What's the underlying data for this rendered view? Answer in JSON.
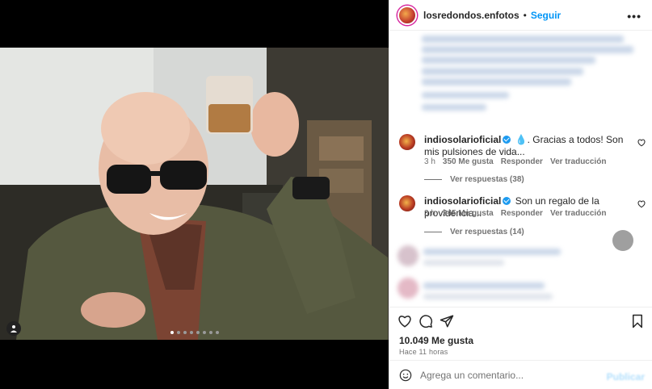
{
  "post": {
    "header": {
      "username": "losredondos.enfotos",
      "separator": "•",
      "follow_label": "Seguir",
      "more_icon": "more-horizontal-icon"
    },
    "comments": [
      {
        "username": "indiosolarioficial",
        "text": " 💧. Gracias a todos! Son mis pulsiones de vida...",
        "time": "3 h",
        "likes": "350 Me gusta",
        "reply": "Responder",
        "translate": "Ver traducción",
        "view_replies": "Ver respuestas (38)"
      },
      {
        "username": "indiosolarioficial",
        "text": " Son un regalo de la providencia...",
        "time": "3 h",
        "likes": "245 Me gusta",
        "reply": "Responder",
        "translate": "Ver traducción",
        "view_replies": "Ver respuestas (14)"
      }
    ],
    "likes_count": "10.049 Me gusta",
    "posted_ago": "Hace 11 horas",
    "comment_box": {
      "placeholder": "Agrega un comentario...",
      "publish_label": "Publicar"
    },
    "carousel": {
      "total": 8,
      "active_index": 0
    },
    "colors": {
      "accent": "#0095f6",
      "verified": "#1d9bf0",
      "muted": "#737373"
    }
  }
}
